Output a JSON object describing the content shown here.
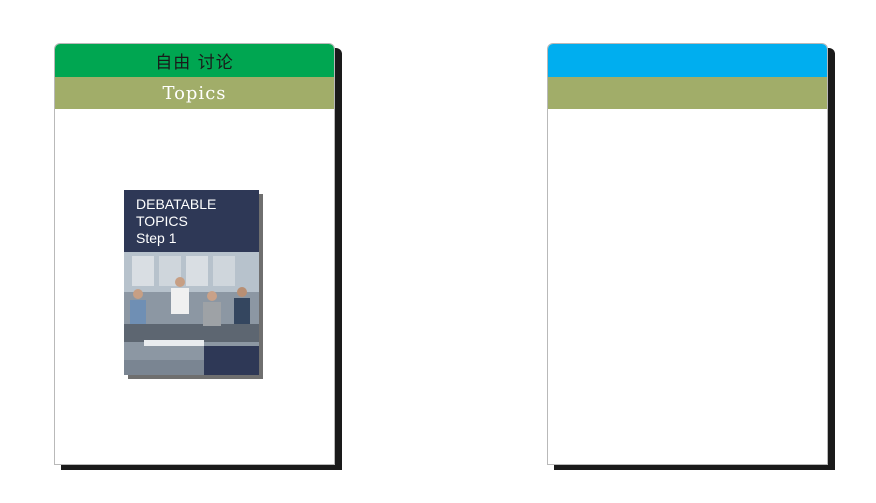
{
  "left_card": {
    "header_title": "自由 讨论",
    "subheader": "Topics",
    "header_color": "#00a651",
    "subheader_color": "#a1ad69",
    "book": {
      "line1": "DEBATABLE",
      "line2": "TOPICS",
      "line3": "Step 1",
      "cover_color": "#2e3856"
    }
  },
  "right_card": {
    "header_color": "#00aeef",
    "subheader_color": "#a1ad69"
  }
}
